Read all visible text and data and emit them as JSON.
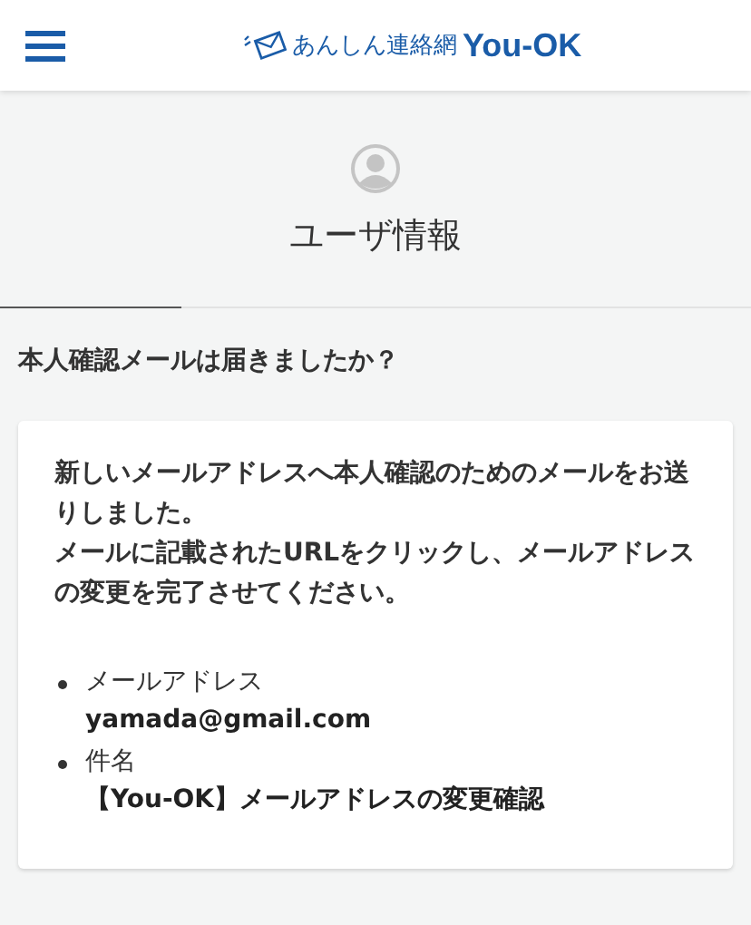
{
  "header": {
    "logo_text": "あんしん連絡網",
    "logo_brand": "You-OK"
  },
  "page": {
    "title": "ユーザ情報"
  },
  "question": "本人確認メールは届きましたか？",
  "card": {
    "message_lines": [
      "新しいメールアドレスへ本人確認のためのメールをお送りしました。",
      "メールに記載されたURLをクリックし、メールアドレスの変更を完了させてください。"
    ],
    "items": [
      {
        "label": "メールアドレス",
        "value": "yamada@gmail.com"
      },
      {
        "label": "件名",
        "value": "【You-OK】メールアドレスの変更確認"
      }
    ]
  }
}
